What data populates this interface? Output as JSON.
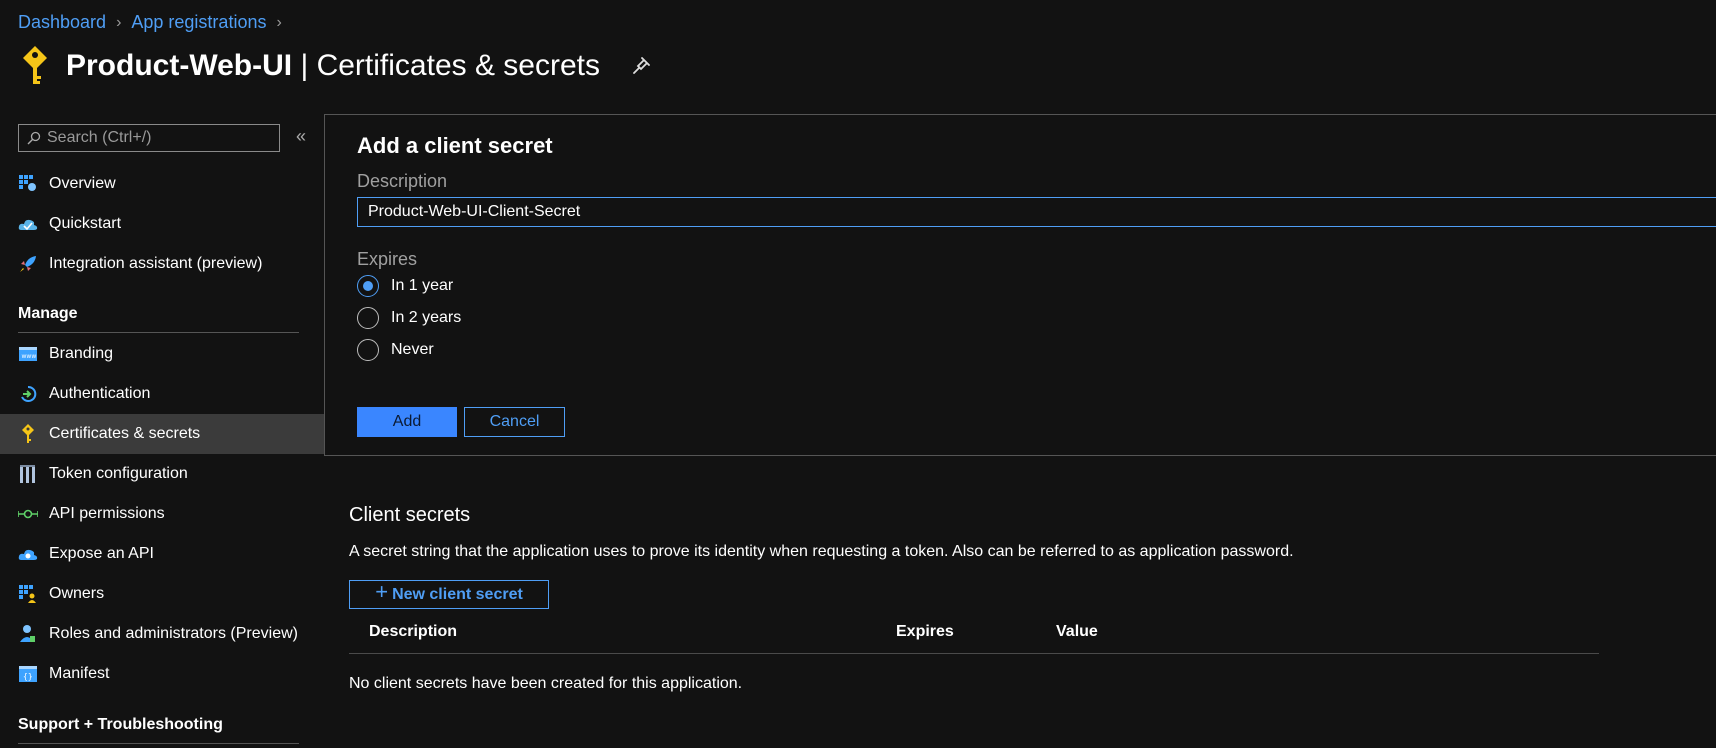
{
  "breadcrumb": [
    {
      "label": "Dashboard"
    },
    {
      "label": "App registrations"
    }
  ],
  "header": {
    "app_name": "Product-Web-UI",
    "separator": " | ",
    "page_name": "Certificates & secrets",
    "icon": "key-icon"
  },
  "sidebar": {
    "search_placeholder": "Search (Ctrl+/)",
    "collapse_glyph": "«",
    "items_top": [
      {
        "label": "Overview",
        "icon": "overview-icon"
      },
      {
        "label": "Quickstart",
        "icon": "quickstart-icon"
      },
      {
        "label": "Integration assistant (preview)",
        "icon": "rocket-icon"
      }
    ],
    "manage_header": "Manage",
    "items_manage": [
      {
        "label": "Branding",
        "icon": "branding-icon"
      },
      {
        "label": "Authentication",
        "icon": "authentication-icon"
      },
      {
        "label": "Certificates & secrets",
        "icon": "key-icon",
        "selected": true
      },
      {
        "label": "Token configuration",
        "icon": "token-icon"
      },
      {
        "label": "API permissions",
        "icon": "api-permissions-icon"
      },
      {
        "label": "Expose an API",
        "icon": "cloud-icon"
      },
      {
        "label": "Owners",
        "icon": "owners-icon"
      },
      {
        "label": "Roles and administrators (Preview)",
        "icon": "roles-icon"
      },
      {
        "label": "Manifest",
        "icon": "manifest-icon"
      }
    ],
    "support_header": "Support + Troubleshooting"
  },
  "panel": {
    "title": "Add a client secret",
    "description_label": "Description",
    "description_value": "Product-Web-UI-Client-Secret",
    "expires_label": "Expires",
    "options": [
      {
        "label": "In 1 year",
        "checked": true
      },
      {
        "label": "In 2 years",
        "checked": false
      },
      {
        "label": "Never",
        "checked": false
      }
    ],
    "add_label": "Add",
    "cancel_label": "Cancel"
  },
  "client_secrets": {
    "title": "Client secrets",
    "description": "A secret string that the application uses to prove its identity when requesting a token. Also can be referred to as application password.",
    "new_button_label": "New client secret",
    "columns": [
      "Description",
      "Expires",
      "Value"
    ],
    "empty_text": "No client secrets have been created for this application."
  },
  "colors": {
    "background": "#121212",
    "accent": "#4f9ef5",
    "primary_button": "#3a86ff",
    "key_icon": "#f5c518"
  }
}
